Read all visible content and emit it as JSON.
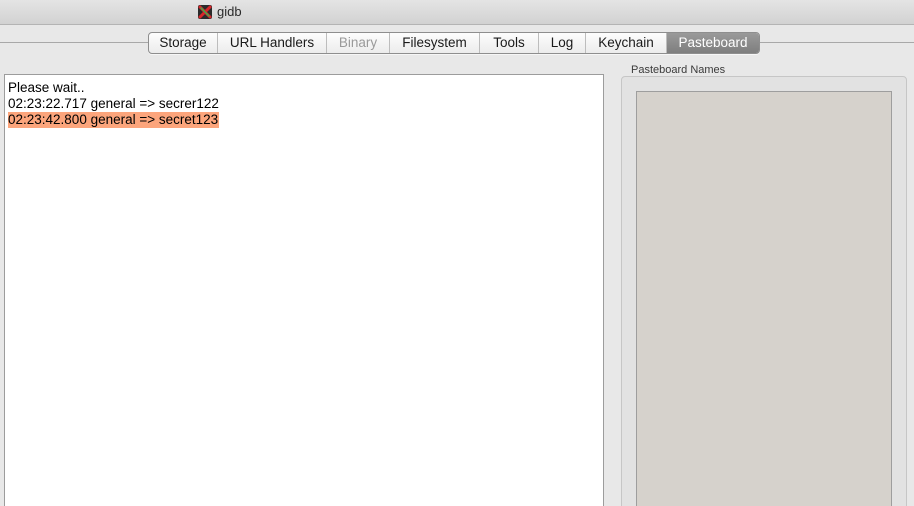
{
  "window": {
    "title": "gidb"
  },
  "tabs": [
    {
      "label": "Storage",
      "state": "normal"
    },
    {
      "label": "URL Handlers",
      "state": "normal"
    },
    {
      "label": "Binary",
      "state": "disabled"
    },
    {
      "label": "Filesystem",
      "state": "normal"
    },
    {
      "label": "Tools",
      "state": "normal"
    },
    {
      "label": "Log",
      "state": "normal"
    },
    {
      "label": "Keychain",
      "state": "normal"
    },
    {
      "label": "Pasteboard",
      "state": "selected"
    }
  ],
  "log": {
    "lines": [
      "Please wait..",
      "02:23:22.717 general => secrer122",
      "02:23:42.800 general => secret123"
    ],
    "highlight_color": "#fca57c"
  },
  "pasteboard_names": {
    "label": "Pasteboard Names",
    "items": []
  },
  "colors": {
    "selected_tab": "#8a8a8a",
    "list_background": "#d6d2cc"
  },
  "icons": {
    "app": "gidb-app-icon"
  }
}
